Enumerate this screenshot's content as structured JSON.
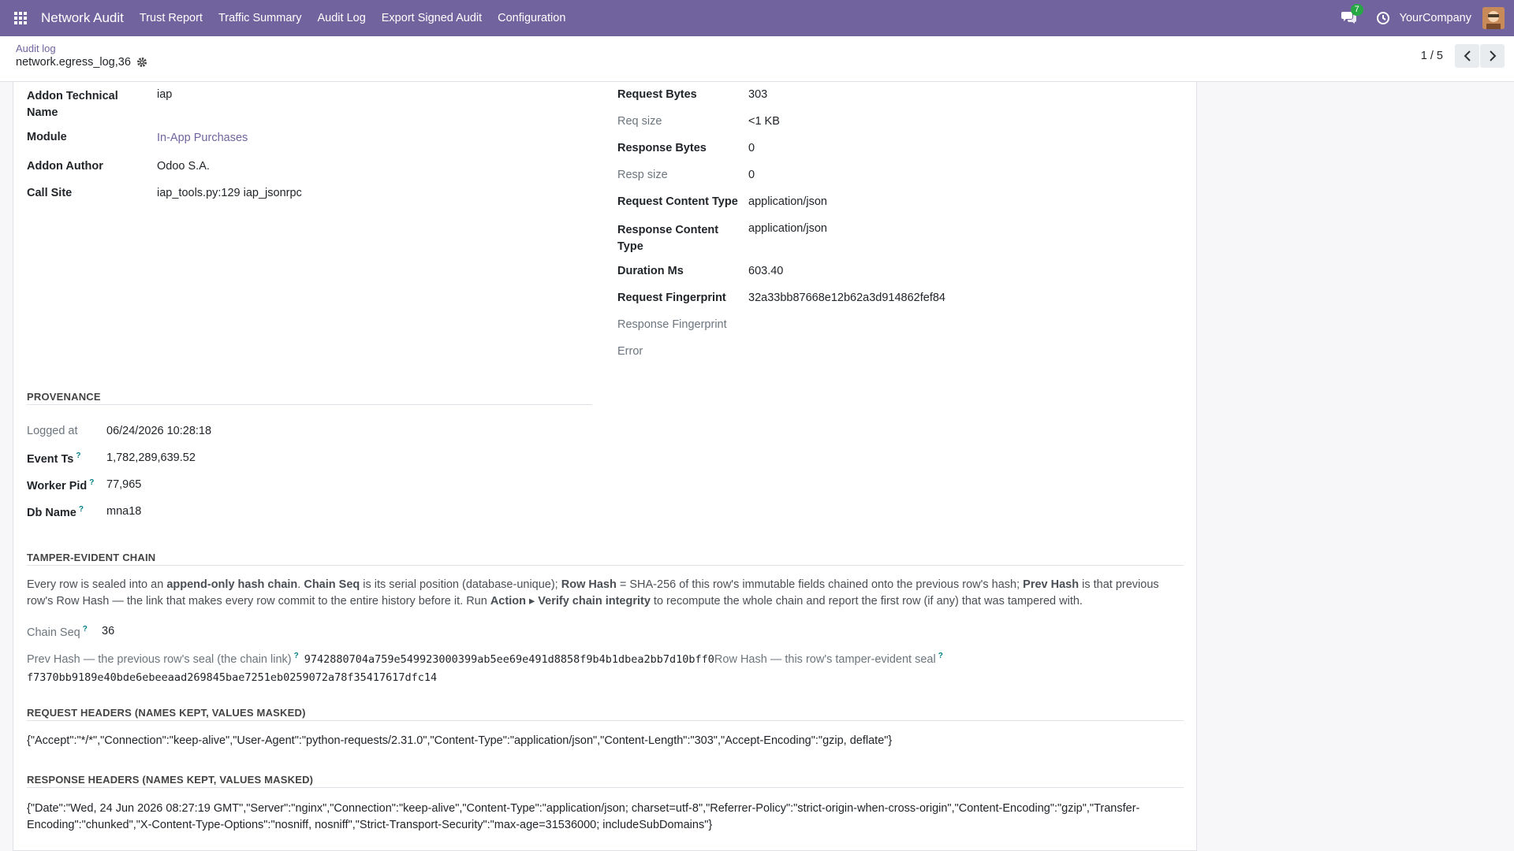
{
  "navbar": {
    "brand": "Network Audit",
    "menu": [
      "Trust Report",
      "Traffic Summary",
      "Audit Log",
      "Export Signed Audit",
      "Configuration"
    ],
    "chat_count": "7",
    "company": "YourCompany"
  },
  "control": {
    "breadcrumb": "Audit log",
    "record": "network.egress_log,36",
    "pager": "1 / 5"
  },
  "left_fields": [
    {
      "label": "Addon Technical Name",
      "value": "iap"
    },
    {
      "label": "Module",
      "value": "In-App Purchases"
    },
    {
      "label": "Addon Author",
      "value": "Odoo S.A."
    },
    {
      "label": "Call Site",
      "value": "iap_tools.py:129 iap_jsonrpc"
    }
  ],
  "right_fields": [
    {
      "label": "Request Bytes",
      "value": "303"
    },
    {
      "label": "Req size",
      "value": "<1 KB"
    },
    {
      "label": "Response Bytes",
      "value": "0"
    },
    {
      "label": "Resp size",
      "value": "0"
    },
    {
      "label": "Request Content Type",
      "value": "application/json"
    },
    {
      "label": "Response Content Type",
      "value": "application/json"
    },
    {
      "label": "Duration Ms",
      "value": "603.40"
    },
    {
      "label": "Request Fingerprint",
      "value": "32a33bb87668e12b62a3d914862fef84"
    },
    {
      "label": "Response Fingerprint",
      "value": ""
    },
    {
      "label": "Error",
      "value": ""
    }
  ],
  "provenance": {
    "title": "PROVENANCE",
    "fields": [
      {
        "label": "Logged at",
        "value": "06/24/2026 10:28:18"
      },
      {
        "label": "Event Ts",
        "value": "1,782,289,639.52"
      },
      {
        "label": "Worker Pid",
        "value": "77,965"
      },
      {
        "label": "Db Name",
        "value": "mna18"
      }
    ]
  },
  "chain": {
    "title": "TAMPER-EVIDENT CHAIN",
    "p1": "Every row is sealed into an ",
    "b1": "append-only hash chain",
    "p2": ". ",
    "b2": "Chain Seq",
    "p3": " is its serial position (database-unique); ",
    "b3": "Row Hash",
    "p4": " = SHA-256 of this row's immutable fields chained onto the previous row's hash; ",
    "b4": "Prev Hash",
    "p5": " is that previous row's Row Hash — the link that makes every row commit to the entire history before it. Run ",
    "b5": "Action ▸ Verify chain integrity",
    "p6": " to recompute the whole chain and report the first row (if any) that was tampered with.",
    "seq_label": "Chain Seq",
    "seq_value": "36",
    "prev_label": "Prev Hash — the previous row's seal (the chain link)",
    "prev_value": "9742880704a759e549923000399ab5ee69e491d8858f9b4b1dbea2bb7d10bff0",
    "row_label": "Row Hash — this row's tamper-evident seal",
    "row_value": "f7370bb9189e40bde6ebeeaad269845bae7251eb0259072a78f35417617dfc14"
  },
  "req_headers": {
    "title": "REQUEST HEADERS (NAMES KEPT, VALUES MASKED)",
    "value": "{\"Accept\":\"*/*\",\"Connection\":\"keep-alive\",\"User-Agent\":\"python-requests/2.31.0\",\"Content-Type\":\"application/json\",\"Content-Length\":\"303\",\"Accept-Encoding\":\"gzip, deflate\"}"
  },
  "resp_headers": {
    "title": "RESPONSE HEADERS (NAMES KEPT, VALUES MASKED)",
    "value": "{\"Date\":\"Wed, 24 Jun 2026 08:27:19 GMT\",\"Server\":\"nginx\",\"Connection\":\"keep-alive\",\"Content-Type\":\"application/json; charset=utf-8\",\"Referrer-Policy\":\"strict-origin-when-cross-origin\",\"Content-Encoding\":\"gzip\",\"Transfer-Encoding\":\"chunked\",\"X-Content-Type-Options\":\"nosniff, nosniff\",\"Strict-Transport-Security\":\"max-age=31536000; includeSubDomains\"}"
  },
  "colors": {
    "navbar": "#71639e",
    "link": "#71639e",
    "help": "#017e84",
    "badge": "#28a745"
  }
}
